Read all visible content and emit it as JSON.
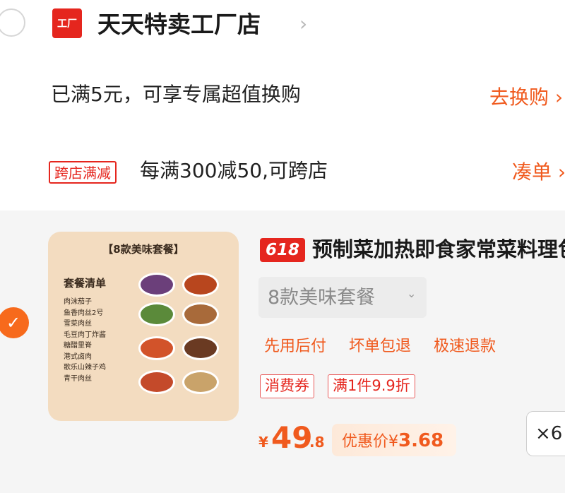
{
  "header": {
    "shop_logo_text": "工厂",
    "shop_name": "天天特卖工厂店",
    "chevron": "›"
  },
  "promos": {
    "exchange_text": "已满5元，可享专属超值换购",
    "exchange_link": "去换购 ›",
    "cross_store_tag": "跨店满减",
    "cross_store_text": "每满300减50,可跨店",
    "cross_store_link": "凑单 ›"
  },
  "product": {
    "selected": true,
    "badge": "618",
    "title": "预制菜加热即食家常菜料理包",
    "image": {
      "title": "【8款美味套餐】",
      "list_title": "套餐清单",
      "list_items": [
        "肉沫茄子",
        "鱼香肉丝2号",
        "雪菜肉丝",
        "毛豆肉丁炸酱",
        "糖醋里脊",
        "港式卤肉",
        "歌乐山辣子鸡",
        "青干肉丝"
      ]
    },
    "spec_value": "8款美味套餐",
    "services": [
      "先用后付",
      "坏单包退",
      "极速退款"
    ],
    "coupons": [
      "消费券",
      "满1件9.9折"
    ],
    "price_symbol": "¥",
    "price_integer": "49",
    "price_decimal": ".8",
    "discount_label": "优惠价¥",
    "discount_value": "3.68",
    "quantity": "×6"
  },
  "colors": {
    "accent": "#f05a1e",
    "brand_red": "#e5261e",
    "check_orange": "#f76a1c"
  }
}
